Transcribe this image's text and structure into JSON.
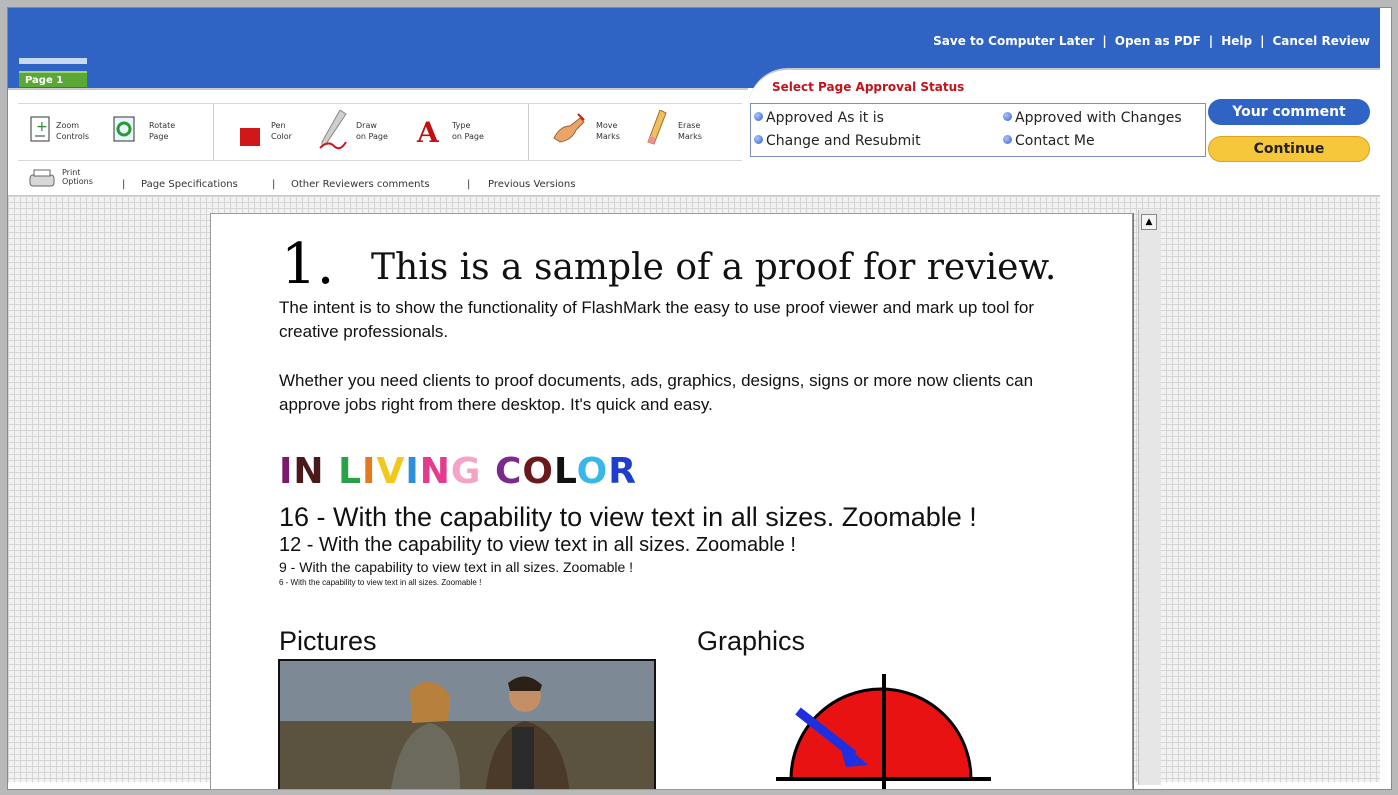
{
  "top_links": [
    "Save to Computer Later",
    "Open as PDF",
    "Help",
    "Cancel Review"
  ],
  "page_tab": "Page 1",
  "tools": {
    "zoom": [
      "Zoom",
      "Controls"
    ],
    "rotate": [
      "Rotate",
      "Page"
    ],
    "pen": [
      "Pen",
      "Color"
    ],
    "draw": [
      "Draw",
      "on Page"
    ],
    "type": [
      "Type",
      "on Page"
    ],
    "move": [
      "Move",
      "Marks"
    ],
    "erase": [
      "Erase",
      "Marks"
    ]
  },
  "links": {
    "print": [
      "Print",
      "Options"
    ],
    "items": [
      "Page Specifications",
      "Other Reviewers comments",
      "Previous Versions"
    ]
  },
  "approval": {
    "title": "Select Page Approval Status",
    "options": [
      "Approved As it is",
      "Approved with Changes",
      "Change and Resubmit",
      "Contact Me"
    ],
    "comment_button": "Your comment",
    "continue_button": "Continue"
  },
  "document": {
    "number": "1.",
    "title": "This is a sample of a proof for review.",
    "para1": "The intent is to show the functionality of FlashMark the easy to use proof viewer and mark up tool for creative professionals.",
    "para2": "Whether you need clients to proof documents, ads, graphics, designs, signs or more now clients can approve jobs right from there desktop. It's quick and easy.",
    "living_color": [
      {
        "ch": "I",
        "color": "#7a1a6e"
      },
      {
        "ch": "N",
        "color": "#4a1a1a"
      },
      {
        "ch": " ",
        "color": "#000000"
      },
      {
        "ch": "L",
        "color": "#2aa047"
      },
      {
        "ch": "I",
        "color": "#e37b1e"
      },
      {
        "ch": "V",
        "color": "#f2c81a"
      },
      {
        "ch": "I",
        "color": "#2d8fd6"
      },
      {
        "ch": "N",
        "color": "#e53a8d"
      },
      {
        "ch": "G",
        "color": "#f5a3c7"
      },
      {
        "ch": " ",
        "color": "#000000"
      },
      {
        "ch": "C",
        "color": "#7a2a8c"
      },
      {
        "ch": "O",
        "color": "#6a1a1a"
      },
      {
        "ch": "L",
        "color": "#111111"
      },
      {
        "ch": "O",
        "color": "#38b7e8"
      },
      {
        "ch": "R",
        "color": "#1f3ed0"
      }
    ],
    "sizes": [
      "16 - With the capability to view text in all sizes. Zoomable !",
      "12 - With the capability to view text in all sizes. Zoomable !",
      "9 - With the capability to view text in all sizes. Zoomable !",
      "6 - With the capability to view text in all sizes. Zoomable !"
    ],
    "pictures_label": "Pictures",
    "graphics_label": "Graphics"
  }
}
